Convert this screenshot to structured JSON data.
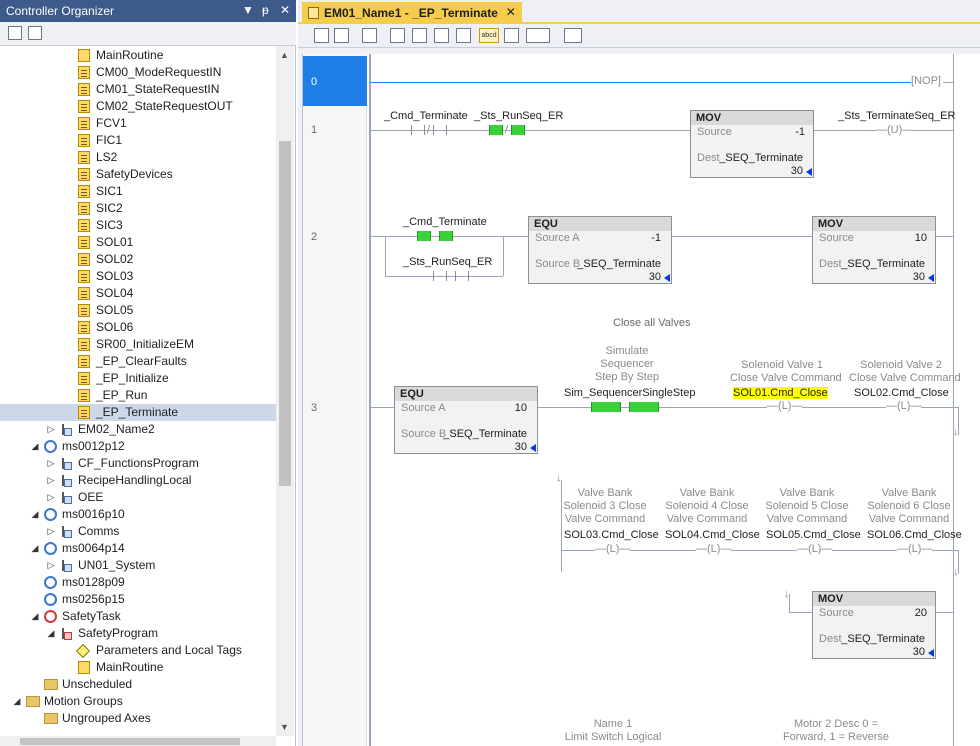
{
  "organizer": {
    "title": "Controller Organizer",
    "controls": {
      "dropdown": "▼",
      "pin": "ᵽ",
      "close": "✕"
    },
    "tree": [
      {
        "label": "MainRoutine",
        "icon": "main-routine-icon"
      },
      {
        "label": "CM00_ModeRequestIN",
        "icon": "routine-icon"
      },
      {
        "label": "CM01_StateRequestIN",
        "icon": "routine-icon"
      },
      {
        "label": "CM02_StateRequestOUT",
        "icon": "routine-icon"
      },
      {
        "label": "FCV1",
        "icon": "routine-icon"
      },
      {
        "label": "FIC1",
        "icon": "routine-icon"
      },
      {
        "label": "LS2",
        "icon": "routine-icon"
      },
      {
        "label": "SafetyDevices",
        "icon": "routine-icon"
      },
      {
        "label": "SIC1",
        "icon": "routine-icon"
      },
      {
        "label": "SIC2",
        "icon": "routine-icon"
      },
      {
        "label": "SIC3",
        "icon": "routine-icon"
      },
      {
        "label": "SOL01",
        "icon": "routine-icon"
      },
      {
        "label": "SOL02",
        "icon": "routine-icon"
      },
      {
        "label": "SOL03",
        "icon": "routine-icon"
      },
      {
        "label": "SOL04",
        "icon": "routine-icon"
      },
      {
        "label": "SOL05",
        "icon": "routine-icon"
      },
      {
        "label": "SOL06",
        "icon": "routine-icon"
      },
      {
        "label": "SR00_InitializeEM",
        "icon": "routine-icon"
      },
      {
        "label": "_EP_ClearFaults",
        "icon": "routine-icon"
      },
      {
        "label": "_EP_Initialize",
        "icon": "routine-icon"
      },
      {
        "label": "_EP_Run",
        "icon": "routine-icon"
      },
      {
        "label": "_EP_Terminate",
        "icon": "routine-icon",
        "selected": true
      },
      {
        "label": "EM02_Name2",
        "icon": "program-icon"
      },
      {
        "label": "ms0012p12",
        "icon": "task-icon"
      },
      {
        "label": "CF_FunctionsProgram",
        "icon": "program-icon"
      },
      {
        "label": "RecipeHandlingLocal",
        "icon": "program-icon"
      },
      {
        "label": "OEE",
        "icon": "program-icon"
      },
      {
        "label": "ms0016p10",
        "icon": "task-icon"
      },
      {
        "label": "Comms",
        "icon": "program-icon"
      },
      {
        "label": "ms0064p14",
        "icon": "task-icon"
      },
      {
        "label": "UN01_System",
        "icon": "program-icon"
      },
      {
        "label": "ms0128p09",
        "icon": "task-icon"
      },
      {
        "label": "ms0256p15",
        "icon": "task-icon"
      },
      {
        "label": "SafetyTask",
        "icon": "safety-task-icon"
      },
      {
        "label": "SafetyProgram",
        "icon": "safety-program-icon"
      },
      {
        "label": "Parameters and Local Tags",
        "icon": "tag-icon"
      },
      {
        "label": "MainRoutine",
        "icon": "main-routine-icon"
      },
      {
        "label": "Unscheduled",
        "icon": "folder-icon"
      },
      {
        "label": "Motion Groups",
        "icon": "folder-icon"
      },
      {
        "label": "Ungrouped Axes",
        "icon": "folder-icon"
      }
    ]
  },
  "editor": {
    "tab_label": "EM01_Name1 - _EP_Terminate",
    "tab_close": "✕",
    "rungs": [
      "0",
      "1",
      "2",
      "3"
    ],
    "rung0": {
      "nop": "NOP"
    },
    "rung1": {
      "xic": "_Cmd_Terminate",
      "xio": "_Sts_RunSeq_ER",
      "mov": {
        "title": "MOV",
        "source_label": "Source",
        "source_value": "-1",
        "dest_label": "Dest",
        "dest_tag": "_SEQ_Terminate",
        "dest_value": "30"
      },
      "otu": "_Sts_TerminateSeq_ER",
      "otu_sym": "U"
    },
    "rung2": {
      "xic1": "_Cmd_Terminate",
      "xic2": "_Sts_RunSeq_ER",
      "equ": {
        "title": "EQU",
        "a_label": "Source A",
        "a_value": "-1",
        "b_label": "Source B",
        "b_tag": "_SEQ_Terminate",
        "b_value": "30"
      },
      "mov": {
        "title": "MOV",
        "source_label": "Source",
        "source_value": "10",
        "dest_label": "Dest",
        "dest_tag": "_SEQ_Terminate",
        "dest_value": "30"
      }
    },
    "rung3": {
      "comment": "Close all Valves",
      "equ": {
        "title": "EQU",
        "a_label": "Source A",
        "a_value": "10",
        "b_label": "Source B",
        "b_tag": "_SEQ_Terminate",
        "b_value": "30"
      },
      "step_desc": [
        "Simulate",
        "Sequencer",
        "Step By Step"
      ],
      "step_tag": "Sim_SequencerSingleStep",
      "coil_sym": "L",
      "sol01_desc": [
        "Solenoid Valve 1",
        "Close Valve Command"
      ],
      "sol01_tag": "SOL01.Cmd_Close",
      "sol02_desc": [
        "Solenoid Valve 2",
        "Close Valve Command"
      ],
      "sol02_tag": "SOL02.Cmd_Close",
      "sol03_desc": [
        "Valve Bank",
        "Solenoid 3 Close",
        "Valve Command"
      ],
      "sol03_tag": "SOL03.Cmd_Close",
      "sol04_desc": [
        "Valve Bank",
        "Solenoid 4 Close",
        "Valve Command"
      ],
      "sol04_tag": "SOL04.Cmd_Close",
      "sol05_desc": [
        "Valve Bank",
        "Solenoid 5 Close",
        "Valve Command"
      ],
      "sol05_tag": "SOL05.Cmd_Close",
      "sol06_desc": [
        "Valve Bank",
        "Solenoid 6 Close",
        "Valve Command"
      ],
      "sol06_tag": "SOL06.Cmd_Close",
      "mov": {
        "title": "MOV",
        "source_label": "Source",
        "source_value": "20",
        "dest_label": "Dest",
        "dest_tag": "_SEQ_Terminate",
        "dest_value": "30"
      }
    },
    "footer_desc1": [
      "Name 1",
      "Limit Switch Logical"
    ],
    "footer_desc2": [
      "Motor 2 Desc 0 =",
      "Forward, 1 = Reverse"
    ]
  },
  "colors": {
    "accent_blue": "#1f7fe6",
    "tab_yellow": "#f5cc4c",
    "energized_green": "#39d339",
    "highlight_yellow": "#ffff00"
  }
}
